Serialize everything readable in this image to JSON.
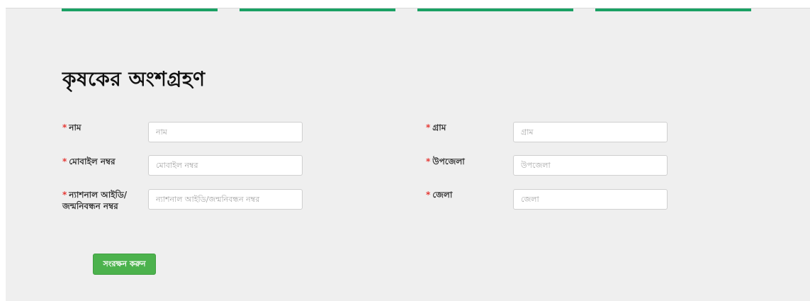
{
  "progress_steps": [
    {
      "name": "step-1"
    },
    {
      "name": "step-2"
    },
    {
      "name": "step-3"
    },
    {
      "name": "step-4"
    }
  ],
  "form": {
    "title": "কৃষকের অংশগ্রহণ",
    "required_mark": "*",
    "fields": {
      "name": {
        "label": "নাম",
        "placeholder": "নাম",
        "value": ""
      },
      "mobile": {
        "label": "মোবাইল নম্বর",
        "placeholder": "মোবাইল নম্বর",
        "value": ""
      },
      "nid": {
        "label": "ন্যাশনাল আইডি/ জন্মনিবন্ধন নম্বর",
        "placeholder": "ন্যাশনাল আইডি/জন্মনিবন্ধন নম্বর",
        "value": ""
      },
      "village": {
        "label": "গ্রাম",
        "placeholder": "গ্রাম",
        "value": ""
      },
      "upazila": {
        "label": "উপজেলা",
        "placeholder": "উপজেলা",
        "value": ""
      },
      "district": {
        "label": "জেলা",
        "placeholder": "জেলা",
        "value": ""
      }
    },
    "save_label": "সংরক্ষন করুন"
  },
  "colors": {
    "accent": "#1aa164",
    "button": "#4cb24d",
    "required": "#e53935",
    "panel_bg": "#efefef"
  }
}
